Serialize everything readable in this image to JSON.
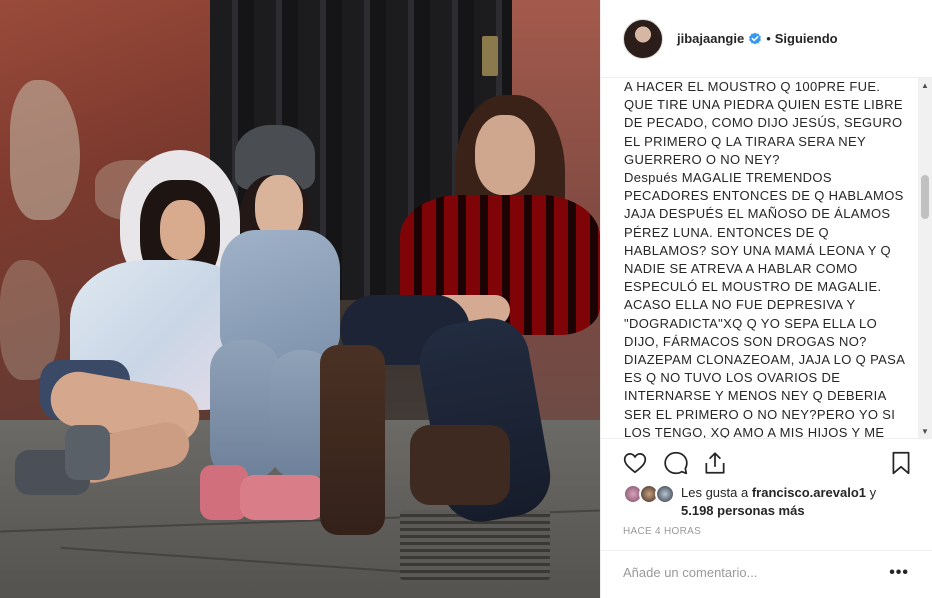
{
  "post": {
    "photo_alt": "Tres mujeres posando frente a una puerta metálica",
    "header": {
      "username": "jibajaangie",
      "separator": "•",
      "follow_status": "Siguiendo"
    },
    "caption_lines": [
      "A HACER EL MOUSTRO Q 100PRE FUE.",
      "QUE TIRE UNA PIEDRA QUIEN ESTE LIBRE",
      "DE PECADO, COMO DIJO JESÚS, SEGURO",
      "EL PRIMERO Q LA TIRARA SERA NEY",
      "GUERRERO O NO NEY?",
      "Después MAGALIE TREMENDOS",
      "PECADORES ENTONCES DE Q HABLAMOS",
      "JAJA DESPUÉS EL MAÑOSO DE ÁLAMOS",
      "PÉREZ LUNA. ENTONCES DE Q",
      "HABLAMOS? SOY UNA MAMÁ LEONA Y Q",
      "NADIE SE ATREVA A HABLAR COMO",
      "ESPECULÓ EL MOUSTRO DE MAGALIE.",
      "ACASO ELLA NO FUE DEPRESIVA Y",
      "\"DOGRADICTA\"XQ Q YO SEPA ELLA LO",
      "DIJO, FÁRMACOS SON DROGAS NO?",
      "DIAZEPAM CLONAZEOAM, JAJA LO Q PASA",
      "ES Q NO TUVO LOS OVARIOS DE",
      "INTERNARSE Y MENOS NEY Q DEBERIA",
      "SER EL PRIMERO O NO NEY?PERO YO SI",
      "LOS TENGO, XQ AMO A MIS HIJOS Y ME"
    ],
    "scrollbar": {
      "up_arrow": "▲",
      "down_arrow": "▼"
    },
    "actions": {
      "like": "heart-icon",
      "comment": "comment-icon",
      "share": "share-icon",
      "save": "bookmark-icon"
    },
    "likes": {
      "prefix": "Les gusta a ",
      "user": "francisco.arevalo1",
      "connector": " y",
      "count": "5.198 personas más"
    },
    "timestamp": "HACE 4 HORAS",
    "comment": {
      "placeholder": "Añade un comentario...",
      "more_label": "•••"
    },
    "colors": {
      "verified": "#3897f0",
      "text": "#262626",
      "muted": "#999999",
      "divider": "#efefef"
    }
  }
}
